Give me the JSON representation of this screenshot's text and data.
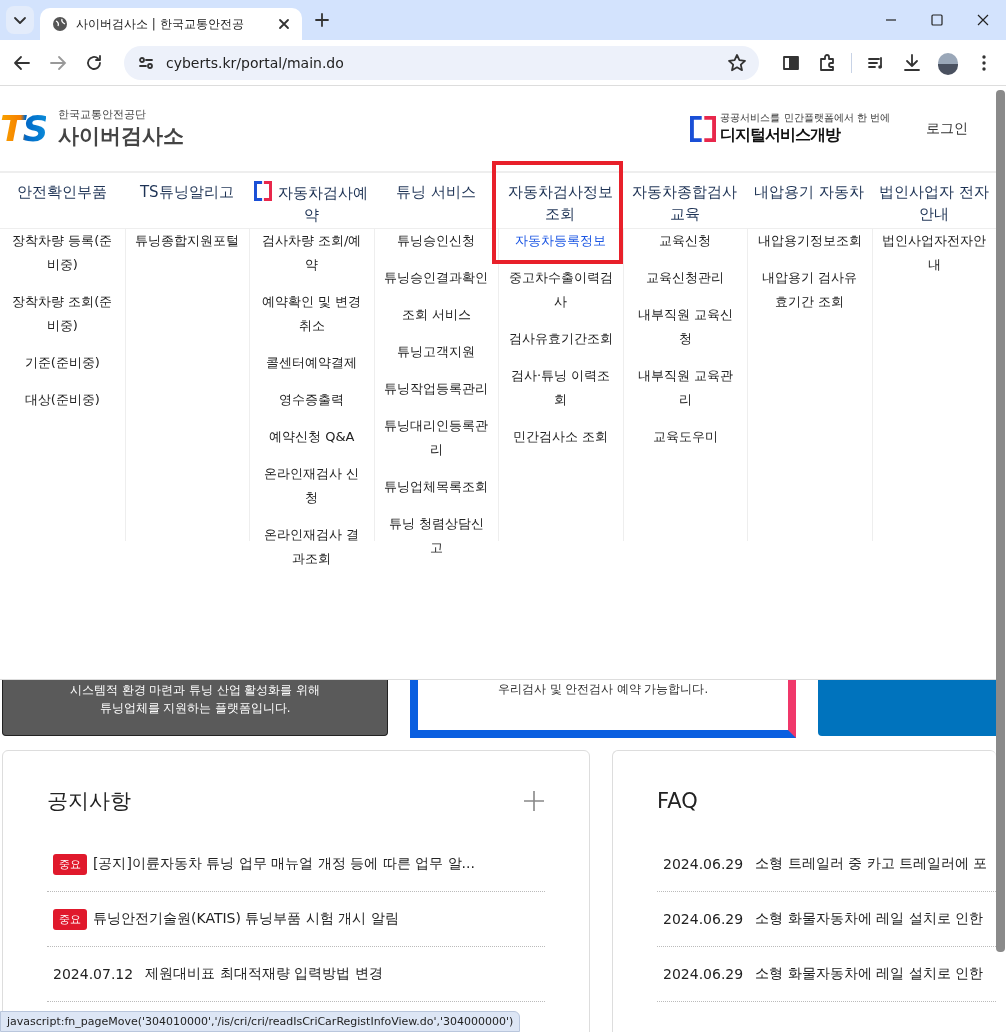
{
  "browser": {
    "tab_title": "사이버검사소 | 한국교통안전공",
    "url": "cyberts.kr/portal/main.do"
  },
  "header": {
    "logo": "TS",
    "org": "한국교통안전공단",
    "site": "사이버검사소",
    "banner_caption": "공공서비스를 민간플랫폼에서 한 번에",
    "banner_title": "디지털서비스개방",
    "login": "로그인"
  },
  "nav": [
    {
      "label": "안전확인부품",
      "icon": false,
      "highlighted": false,
      "items": [
        {
          "label": "장착차량 등록(준비중)",
          "selected": false
        },
        {
          "label": "장착차량 조회(준비중)",
          "selected": false
        },
        {
          "label": "기준(준비중)",
          "selected": false
        },
        {
          "label": "대상(준비중)",
          "selected": false
        }
      ]
    },
    {
      "label": "TS튜닝알리고",
      "icon": false,
      "highlighted": false,
      "items": [
        {
          "label": "튜닝종합지원포털",
          "selected": false
        }
      ]
    },
    {
      "label": "자동차검사예약",
      "icon": true,
      "highlighted": false,
      "items": [
        {
          "label": "검사차량 조회/예약",
          "selected": false
        },
        {
          "label": "예약확인 및 변경취소",
          "selected": false
        },
        {
          "label": "콜센터예약결제",
          "selected": false
        },
        {
          "label": "영수증출력",
          "selected": false
        },
        {
          "label": "예약신청 Q&A",
          "selected": false
        },
        {
          "label": "온라인재검사 신청",
          "selected": false
        },
        {
          "label": "온라인재검사 결과조회",
          "selected": false
        }
      ]
    },
    {
      "label": "튜닝 서비스",
      "icon": false,
      "highlighted": false,
      "items": [
        {
          "label": "튜닝승인신청",
          "selected": false
        },
        {
          "label": "튜닝승인결과확인",
          "selected": false
        },
        {
          "label": "조회 서비스",
          "selected": false
        },
        {
          "label": "튜닝고객지원",
          "selected": false
        },
        {
          "label": "튜닝작업등록관리",
          "selected": false
        },
        {
          "label": "튜닝대리인등록관리",
          "selected": false
        },
        {
          "label": "튜닝업체목록조회",
          "selected": false
        },
        {
          "label": "튜닝 청렴상담신고",
          "selected": false
        }
      ]
    },
    {
      "label": "자동차검사정보조회",
      "icon": false,
      "highlighted": true,
      "items": [
        {
          "label": "자동차등록정보",
          "selected": true
        },
        {
          "label": "중고차수출이력검사",
          "selected": false
        },
        {
          "label": "검사유효기간조회",
          "selected": false
        },
        {
          "label": "검사·튜닝 이력조회",
          "selected": false
        },
        {
          "label": "민간검사소 조회",
          "selected": false
        }
      ]
    },
    {
      "label": "자동차종합검사교육",
      "icon": false,
      "highlighted": false,
      "items": [
        {
          "label": "교육신청",
          "selected": false
        },
        {
          "label": "교육신청관리",
          "selected": false
        },
        {
          "label": "내부직원 교육신청",
          "selected": false
        },
        {
          "label": "내부직원 교육관리",
          "selected": false
        },
        {
          "label": "교육도우미",
          "selected": false
        }
      ]
    },
    {
      "label": "내압용기 자동차",
      "icon": false,
      "highlighted": false,
      "items": [
        {
          "label": "내압용기정보조회",
          "selected": false
        },
        {
          "label": "내압용기 검사유효기간 조회",
          "selected": false
        }
      ]
    },
    {
      "label": "법인사업자 전자안내",
      "icon": false,
      "highlighted": false,
      "items": [
        {
          "label": "법인사업자전자안내",
          "selected": false
        }
      ]
    }
  ],
  "promo_cards": [
    {
      "kind": "dark",
      "lines": [
        "시스템적 환경 마련과 튜닝 산업 활성화를 위해",
        "튜닝업체를 지원하는 플랫폼입니다."
      ]
    },
    {
      "kind": "outlined",
      "lines": [
        "우리검사 및 안전검사 예약 가능합니다."
      ]
    },
    {
      "kind": "blue"
    }
  ],
  "notices": {
    "title": "공지사항",
    "items": [
      {
        "badge": "중요",
        "title": "[공지]이륜자동차 튜닝 업무 매뉴얼 개정 등에 따른 업무 알..."
      },
      {
        "badge": "중요",
        "title": "튜닝안전기술원(KATIS) 튜닝부품 시험 개시 알림"
      },
      {
        "date": "2024.07.12",
        "title": "제원대비표 최대적재량 입력방법 변경"
      }
    ]
  },
  "faq": {
    "title": "FAQ",
    "items": [
      {
        "date": "2024.06.29",
        "title": "소형 트레일러 중 카고 트레일러에 포"
      },
      {
        "date": "2024.06.29",
        "title": "소형 화물자동차에 레일 설치로 인한"
      },
      {
        "date": "2024.06.29",
        "title": "소형 화물자동차에 레일 설치로 인한"
      }
    ]
  },
  "status_url": "javascript:fn_pageMove('304010000','/is/cri/cri/readIsCriCarRegistInfoView.do','304000000')"
}
